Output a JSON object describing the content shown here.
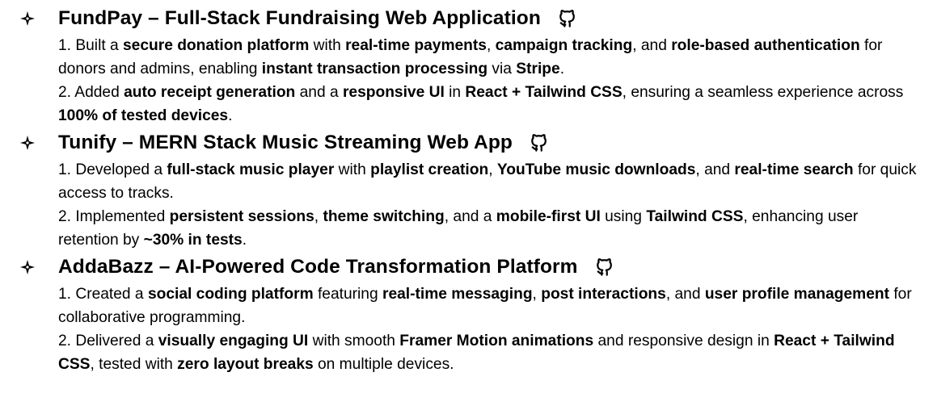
{
  "projects": [
    {
      "title": "FundPay – Full-Stack Fundraising Web Application",
      "github_icon": "github-icon",
      "points": [
        [
          {
            "t": "1. Built a ",
            "b": false
          },
          {
            "t": "secure donation platform",
            "b": true
          },
          {
            "t": " with ",
            "b": false
          },
          {
            "t": "real-time payments",
            "b": true
          },
          {
            "t": ", ",
            "b": false
          },
          {
            "t": "campaign tracking",
            "b": true
          },
          {
            "t": ", and ",
            "b": false
          },
          {
            "t": "role-based authentication",
            "b": true
          },
          {
            "t": " for donors and admins, enabling ",
            "b": false
          },
          {
            "t": "instant transaction processing",
            "b": true
          },
          {
            "t": " via ",
            "b": false
          },
          {
            "t": "Stripe",
            "b": true
          },
          {
            "t": ".",
            "b": false
          }
        ],
        [
          {
            "t": "2. Added ",
            "b": false
          },
          {
            "t": "auto receipt generation",
            "b": true
          },
          {
            "t": " and a ",
            "b": false
          },
          {
            "t": "responsive UI",
            "b": true
          },
          {
            "t": " in ",
            "b": false
          },
          {
            "t": "React + Tailwind CSS",
            "b": true
          },
          {
            "t": ", ensuring a seamless experience across ",
            "b": false
          },
          {
            "t": "100% of tested devices",
            "b": true
          },
          {
            "t": ".",
            "b": false
          }
        ]
      ]
    },
    {
      "title": "Tunify – MERN Stack Music Streaming Web App",
      "github_icon": "github-icon",
      "points": [
        [
          {
            "t": "1. Developed a ",
            "b": false
          },
          {
            "t": "full-stack music player",
            "b": true
          },
          {
            "t": " with ",
            "b": false
          },
          {
            "t": "playlist creation",
            "b": true
          },
          {
            "t": ", ",
            "b": false
          },
          {
            "t": "YouTube music downloads",
            "b": true
          },
          {
            "t": ", and ",
            "b": false
          },
          {
            "t": "real-time search",
            "b": true
          },
          {
            "t": " for quick access to tracks.",
            "b": false
          }
        ],
        [
          {
            "t": "2. Implemented ",
            "b": false
          },
          {
            "t": "persistent sessions",
            "b": true
          },
          {
            "t": ", ",
            "b": false
          },
          {
            "t": "theme switching",
            "b": true
          },
          {
            "t": ", and a ",
            "b": false
          },
          {
            "t": "mobile-first UI",
            "b": true
          },
          {
            "t": " using ",
            "b": false
          },
          {
            "t": "Tailwind CSS",
            "b": true
          },
          {
            "t": ", enhancing user retention by ",
            "b": false
          },
          {
            "t": "~30% in tests",
            "b": true
          },
          {
            "t": ".",
            "b": false
          }
        ]
      ]
    },
    {
      "title": "AddaBazz – AI-Powered Code Transformation Platform",
      "github_icon": "github-icon",
      "points": [
        [
          {
            "t": "1. Created a ",
            "b": false
          },
          {
            "t": "social coding platform",
            "b": true
          },
          {
            "t": " featuring ",
            "b": false
          },
          {
            "t": "real-time messaging",
            "b": true
          },
          {
            "t": ", ",
            "b": false
          },
          {
            "t": "post interactions",
            "b": true
          },
          {
            "t": ", and ",
            "b": false
          },
          {
            "t": "user profile management",
            "b": true
          },
          {
            "t": " for collaborative programming.",
            "b": false
          }
        ],
        [
          {
            "t": "2. Delivered a ",
            "b": false
          },
          {
            "t": "visually engaging UI",
            "b": true
          },
          {
            "t": " with smooth ",
            "b": false
          },
          {
            "t": "Framer Motion animations",
            "b": true
          },
          {
            "t": " and responsive design in ",
            "b": false
          },
          {
            "t": "React + Tailwind CSS",
            "b": true
          },
          {
            "t": ", tested with ",
            "b": false
          },
          {
            "t": "zero layout breaks",
            "b": true
          },
          {
            "t": " on multiple devices.",
            "b": false
          }
        ]
      ]
    }
  ]
}
